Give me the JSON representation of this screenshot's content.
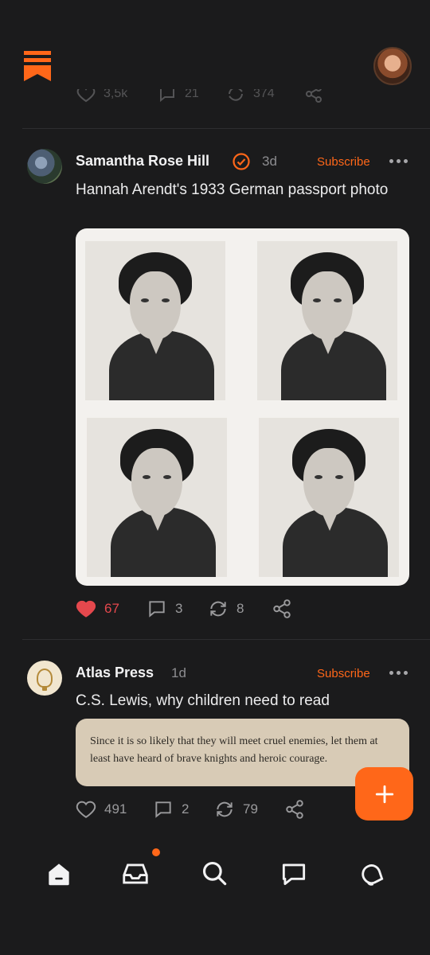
{
  "colors": {
    "background": "#1b1b1c",
    "accent": "#ff6719",
    "like_active": "#e5484d",
    "muted": "#9a9a9c"
  },
  "header": {
    "logo_icon": "substack-logo-icon",
    "avatar_icon": "profile-avatar"
  },
  "ghost_actions": {
    "likes": "3,5k",
    "comments": "21",
    "restacks": "374"
  },
  "posts": [
    {
      "author": "Samantha Rose Hill",
      "time": "3d",
      "subscribe_label": "Subscribe",
      "text": "Hannah Arendt's 1933 German passport photo",
      "likes": "67",
      "comments": "3",
      "restacks": "8",
      "liked": true
    },
    {
      "author": "Atlas Press",
      "time": "1d",
      "subscribe_label": "Subscribe",
      "text": "C.S. Lewis, why children need to read",
      "quote": "Since it is so likely that they will meet cruel enemies, let them at least have heard of brave knights and heroic courage.",
      "likes": "491",
      "comments": "2",
      "restacks": "79",
      "liked": false
    }
  ],
  "fab": {
    "icon": "plus-icon"
  },
  "bottom_nav": [
    "home-icon",
    "inbox-icon",
    "search-icon",
    "chat-icon",
    "activity-icon"
  ]
}
